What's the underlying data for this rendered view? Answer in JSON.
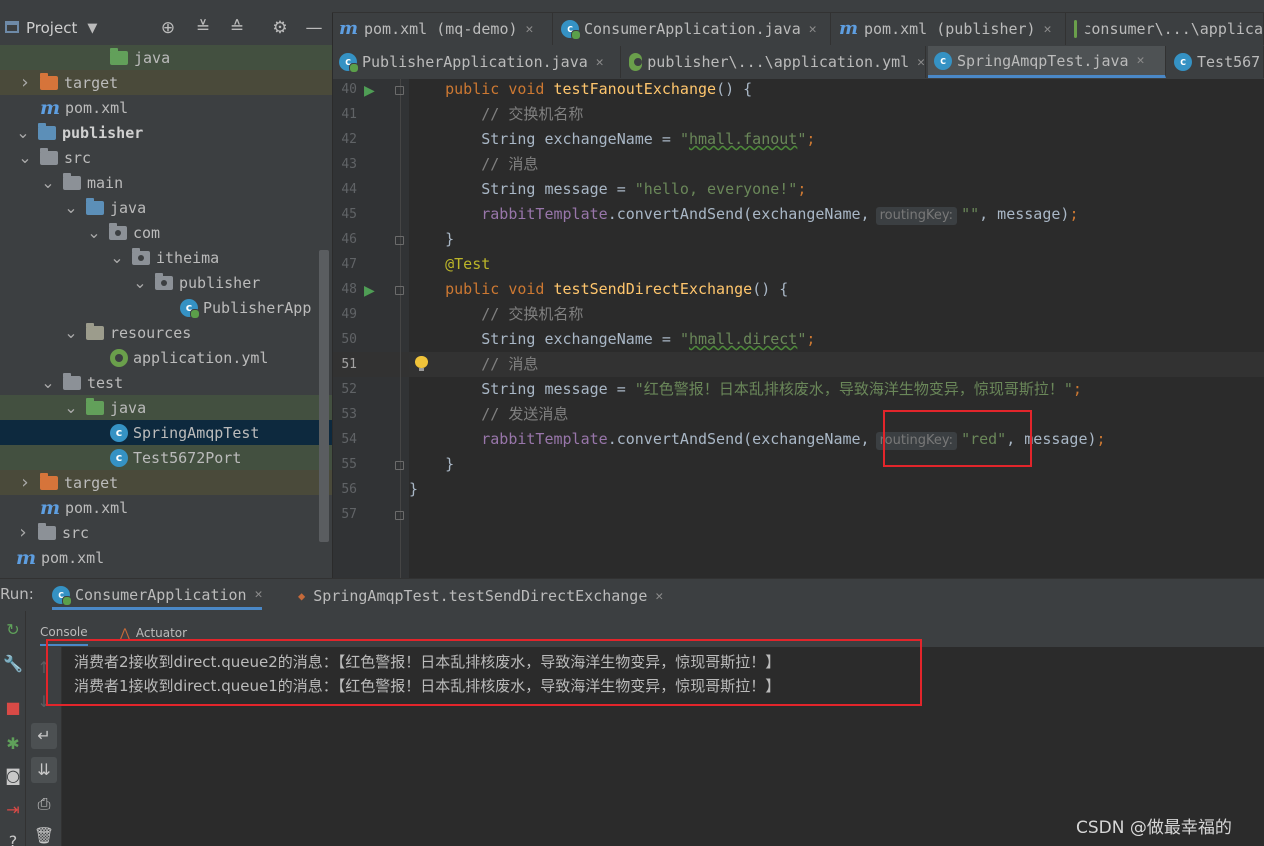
{
  "project_panel": {
    "title": "Project",
    "tree": [
      {
        "label": "java",
        "indent": 110,
        "arrow": "none",
        "icon": "folder-green",
        "tint": "green"
      },
      {
        "label": "target",
        "indent": 40,
        "arrow": "right",
        "icon": "folder-orange",
        "tint": "olive"
      },
      {
        "label": "pom.xml",
        "indent": 40,
        "arrow": "none",
        "icon": "maven"
      },
      {
        "label": "publisher",
        "indent": 16,
        "arrow": "down",
        "icon": "folder-module",
        "bold": true
      },
      {
        "label": "src",
        "indent": 40,
        "arrow": "down",
        "icon": "folder-grey"
      },
      {
        "label": "main",
        "indent": 63,
        "arrow": "down",
        "icon": "folder-grey"
      },
      {
        "label": "java",
        "indent": 86,
        "arrow": "down",
        "icon": "folder-blue"
      },
      {
        "label": "com",
        "indent": 109,
        "arrow": "down",
        "icon": "package"
      },
      {
        "label": "itheima",
        "indent": 132,
        "arrow": "down",
        "icon": "package"
      },
      {
        "label": "publisher",
        "indent": 155,
        "arrow": "down",
        "icon": "package"
      },
      {
        "label": "PublisherApp",
        "indent": 180,
        "arrow": "none",
        "icon": "spring-class"
      },
      {
        "label": "resources",
        "indent": 86,
        "arrow": "down",
        "icon": "folder-res"
      },
      {
        "label": "application.yml",
        "indent": 110,
        "arrow": "none",
        "icon": "yml"
      },
      {
        "label": "test",
        "indent": 63,
        "arrow": "down",
        "icon": "folder-grey"
      },
      {
        "label": "java",
        "indent": 86,
        "arrow": "down",
        "icon": "folder-green",
        "tint": "green"
      },
      {
        "label": "SpringAmqpTest",
        "indent": 110,
        "arrow": "none",
        "icon": "class",
        "selected": true
      },
      {
        "label": "Test5672Port",
        "indent": 110,
        "arrow": "none",
        "icon": "class",
        "tint": "green"
      },
      {
        "label": "target",
        "indent": 40,
        "arrow": "right",
        "icon": "folder-orange",
        "tint": "olive"
      },
      {
        "label": "pom.xml",
        "indent": 40,
        "arrow": "none",
        "icon": "maven"
      },
      {
        "label": "src",
        "indent": 16,
        "arrow": "right",
        "icon": "folder-grey"
      },
      {
        "label": "pom.xml",
        "indent": 16,
        "arrow": "none",
        "icon": "maven"
      }
    ]
  },
  "editor_tabs": {
    "row1": [
      {
        "label": "pom.xml (mq-demo)",
        "icon": "maven"
      },
      {
        "label": "ConsumerApplication.java",
        "icon": "spring-class"
      },
      {
        "label": "pom.xml (publisher)",
        "icon": "maven"
      },
      {
        "label": "consumer\\...\\applica",
        "icon": "yml"
      }
    ],
    "row2": [
      {
        "label": "PublisherApplication.java",
        "icon": "spring-class"
      },
      {
        "label": "publisher\\...\\application.yml",
        "icon": "yml"
      },
      {
        "label": "SpringAmqpTest.java",
        "icon": "class",
        "active": true
      },
      {
        "label": "Test567",
        "icon": "class"
      }
    ]
  },
  "editor": {
    "current_line": "51",
    "lines": [
      {
        "n": "40"
      },
      {
        "n": "41"
      },
      {
        "n": "42"
      },
      {
        "n": "43"
      },
      {
        "n": "44"
      },
      {
        "n": "45"
      },
      {
        "n": "46"
      },
      {
        "n": "47"
      },
      {
        "n": "48"
      },
      {
        "n": "49"
      },
      {
        "n": "50"
      },
      {
        "n": "51"
      },
      {
        "n": "52"
      },
      {
        "n": "53"
      },
      {
        "n": "54"
      },
      {
        "n": "55"
      },
      {
        "n": "56"
      },
      {
        "n": "57"
      }
    ],
    "code": {
      "l40_kw": "public void ",
      "l40_fn": "testFanoutExchange",
      "l40_rest": "() {",
      "l41_cm": "// 交换机名称",
      "l42_a": "String exchangeName = ",
      "l42_str_q1": "\"",
      "l42_str": "hmall.fanout",
      "l42_str_q2": "\"",
      "l42_semi": ";",
      "l43_cm": "// 消息",
      "l44_a": "String message = ",
      "l44_str": "\"hello, everyone!\"",
      "l44_semi": ";",
      "l45_fld": "rabbitTemplate",
      "l45_a": ".convertAndSend(exchangeName,",
      "l45_hint": "routingKey:",
      "l45_str": "\"\"",
      "l45_b": ", message)",
      "l45_semi": ";",
      "l46": "}",
      "l47_ann": "@Test",
      "l48_kw": "public void ",
      "l48_fn": "testSendDirectExchange",
      "l48_rest": "() {",
      "l49_cm": "// 交换机名称",
      "l50_a": "String exchangeName = ",
      "l50_str_q1": "\"",
      "l50_str": "hmall.direct",
      "l50_str_q2": "\"",
      "l50_semi": ";",
      "l51_cm": "// 消息",
      "l52_a": "String message = ",
      "l52_str": "\"红色警报！日本乱排核废水，导致海洋生物变异，惊现哥斯拉！\"",
      "l52_semi": ";",
      "l53_cm": "// 发送消息",
      "l54_fld": "rabbitTemplate",
      "l54_a": ".convertAndSend(exchangeName,",
      "l54_hint": "routingKey:",
      "l54_str": "\"red\"",
      "l54_b": ", message)",
      "l54_semi": ";",
      "l55": "}",
      "l56": "}"
    }
  },
  "run_panel": {
    "label": "Run:",
    "tabs": [
      {
        "label": "ConsumerApplication",
        "active": true
      },
      {
        "label": "SpringAmqpTest.testSendDirectExchange"
      }
    ],
    "subtabs": {
      "console": "Console",
      "actuator": "Actuator"
    },
    "console_lines": [
      "消费者2接收到direct.queue2的消息：【红色警报！日本乱排核废水，导致海洋生物变异，惊现哥斯拉！】",
      "消费者1接收到direct.queue1的消息：【红色警报！日本乱排核废水，导致海洋生物变异，惊现哥斯拉！】"
    ]
  },
  "watermark": "CSDN @做最幸福的",
  "colors": {
    "highlight_box": "#e2252b",
    "accent": "#4a88c7"
  }
}
